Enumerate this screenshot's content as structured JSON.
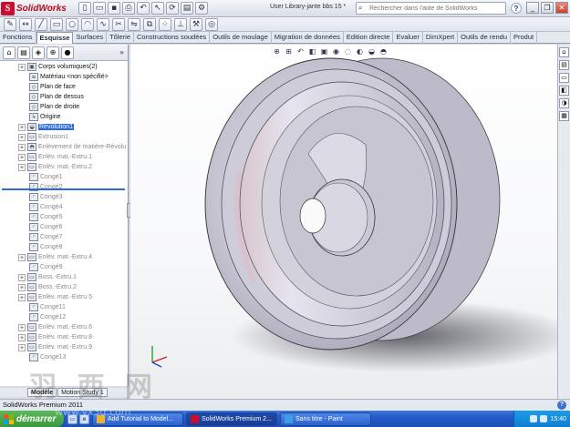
{
  "app": {
    "logo_text": "SolidWorks",
    "document_title": "User Library-jante bbs 15 *",
    "search_placeholder": "Rechercher dans l'aide de SolidWorks",
    "toolbar_icons": [
      "new-icon",
      "open-icon",
      "save-icon",
      "print-icon",
      "undo-icon",
      "select-icon",
      "rebuild-icon",
      "options-icon"
    ],
    "window_controls": {
      "minimize": "_",
      "restore": "❐",
      "close": "✕"
    }
  },
  "tabs": [
    {
      "label": "Fonctions",
      "active": false
    },
    {
      "label": "Esquisse",
      "active": true
    },
    {
      "label": "Surfaces",
      "active": false
    },
    {
      "label": "Tôlerie",
      "active": false
    },
    {
      "label": "Constructions soudées",
      "active": false
    },
    {
      "label": "Outils de moulage",
      "active": false
    },
    {
      "label": "Migration de données",
      "active": false
    },
    {
      "label": "Edition directe",
      "active": false
    },
    {
      "label": "Evaluer",
      "active": false
    },
    {
      "label": "DimXpert",
      "active": false
    },
    {
      "label": "Outils de rendu",
      "active": false
    },
    {
      "label": "Produt",
      "active": false
    }
  ],
  "feature_tree": [
    {
      "label": "Corps volumiques(2)",
      "expander": "+",
      "icon": "folder-icon",
      "dim": false,
      "selected": false
    },
    {
      "label": "Matériau <non spécifié>",
      "expander": "",
      "icon": "material-icon",
      "dim": false,
      "selected": false
    },
    {
      "label": "Plan de face",
      "expander": "",
      "icon": "plane-icon",
      "dim": false,
      "selected": false
    },
    {
      "label": "Plan de dessus",
      "expander": "",
      "icon": "plane-icon",
      "dim": false,
      "selected": false
    },
    {
      "label": "Plan de droite",
      "expander": "",
      "icon": "plane-icon",
      "dim": false,
      "selected": false
    },
    {
      "label": "Origine",
      "expander": "",
      "icon": "origin-icon",
      "dim": false,
      "selected": false
    },
    {
      "label": "Révolution1",
      "expander": "+",
      "icon": "revolve-icon",
      "dim": false,
      "selected": true
    },
    {
      "label": "Extrusion1",
      "expander": "+",
      "icon": "extrude-icon",
      "dim": true,
      "selected": false
    },
    {
      "label": "Enlèvement de matière-Révolu",
      "expander": "+",
      "icon": "cut-revolve-icon",
      "dim": true,
      "selected": false
    },
    {
      "label": "Enlèv. mat.-Extru.1",
      "expander": "+",
      "icon": "cut-extrude-icon",
      "dim": true,
      "selected": false
    },
    {
      "label": "Enlèv. mat.-Extru.2",
      "expander": "+",
      "icon": "cut-extrude-icon",
      "dim": true,
      "selected": false
    },
    {
      "label": "Congé1",
      "expander": "",
      "icon": "fillet-icon",
      "dim": true,
      "selected": false
    },
    {
      "label": "Congé2",
      "expander": "",
      "icon": "fillet-icon",
      "dim": true,
      "selected": false
    },
    {
      "label": "Congé3",
      "expander": "",
      "icon": "fillet-icon",
      "dim": true,
      "selected": false
    },
    {
      "label": "Congé4",
      "expander": "",
      "icon": "fillet-icon",
      "dim": true,
      "selected": false
    },
    {
      "label": "Congé5",
      "expander": "",
      "icon": "fillet-icon",
      "dim": true,
      "selected": false
    },
    {
      "label": "Congé6",
      "expander": "",
      "icon": "fillet-icon",
      "dim": true,
      "selected": false
    },
    {
      "label": "Congé7",
      "expander": "",
      "icon": "fillet-icon",
      "dim": true,
      "selected": false
    },
    {
      "label": "Congé8",
      "expander": "",
      "icon": "fillet-icon",
      "dim": true,
      "selected": false
    },
    {
      "label": "Enlèv. mat.-Extru.4",
      "expander": "+",
      "icon": "cut-extrude-icon",
      "dim": true,
      "selected": false
    },
    {
      "label": "Congé9",
      "expander": "",
      "icon": "fillet-icon",
      "dim": true,
      "selected": false
    },
    {
      "label": "Boss.-Extru.1",
      "expander": "+",
      "icon": "boss-extrude-icon",
      "dim": true,
      "selected": false
    },
    {
      "label": "Boss.-Extru.2",
      "expander": "+",
      "icon": "boss-extrude-icon",
      "dim": true,
      "selected": false
    },
    {
      "label": "Enlèv. mat.-Extru.5",
      "expander": "+",
      "icon": "cut-extrude-icon",
      "dim": true,
      "selected": false
    },
    {
      "label": "Congé11",
      "expander": "",
      "icon": "fillet-icon",
      "dim": true,
      "selected": false
    },
    {
      "label": "Congé12",
      "expander": "",
      "icon": "fillet-icon",
      "dim": true,
      "selected": false
    },
    {
      "label": "Enlèv. mat.-Extru.6",
      "expander": "+",
      "icon": "cut-extrude-icon",
      "dim": true,
      "selected": false
    },
    {
      "label": "Enlèv. mat.-Extru.8",
      "expander": "+",
      "icon": "cut-extrude-icon",
      "dim": true,
      "selected": false
    },
    {
      "label": "Enlèv. mat.-Extru.9",
      "expander": "+",
      "icon": "cut-extrude-icon",
      "dim": true,
      "selected": false
    },
    {
      "label": "Congé13",
      "expander": "",
      "icon": "fillet-icon",
      "dim": true,
      "selected": false
    }
  ],
  "bottom_tabs": [
    {
      "label": "Modèle",
      "active": true
    },
    {
      "label": "Motion Study 1",
      "active": false
    }
  ],
  "status": {
    "text": "SolidWorks Premium 2011"
  },
  "taskbar": {
    "start_label": "démarrer",
    "buttons": [
      {
        "label": "Add Tutorial to Model...",
        "active": false,
        "color": "#f0b030"
      },
      {
        "label": "SolidWorks Premium 2...",
        "active": true,
        "color": "#c8102e"
      },
      {
        "label": "Sans titre - Paint",
        "active": false,
        "color": "#3aa0e0"
      }
    ],
    "clock": "15:40"
  },
  "watermark": {
    "text": "羽 西 网",
    "sub": "www.yx3d.com"
  },
  "colors": {
    "accent": "#2f6bd8",
    "brand": "#c8102e",
    "wheel": "#c9c7d3"
  }
}
